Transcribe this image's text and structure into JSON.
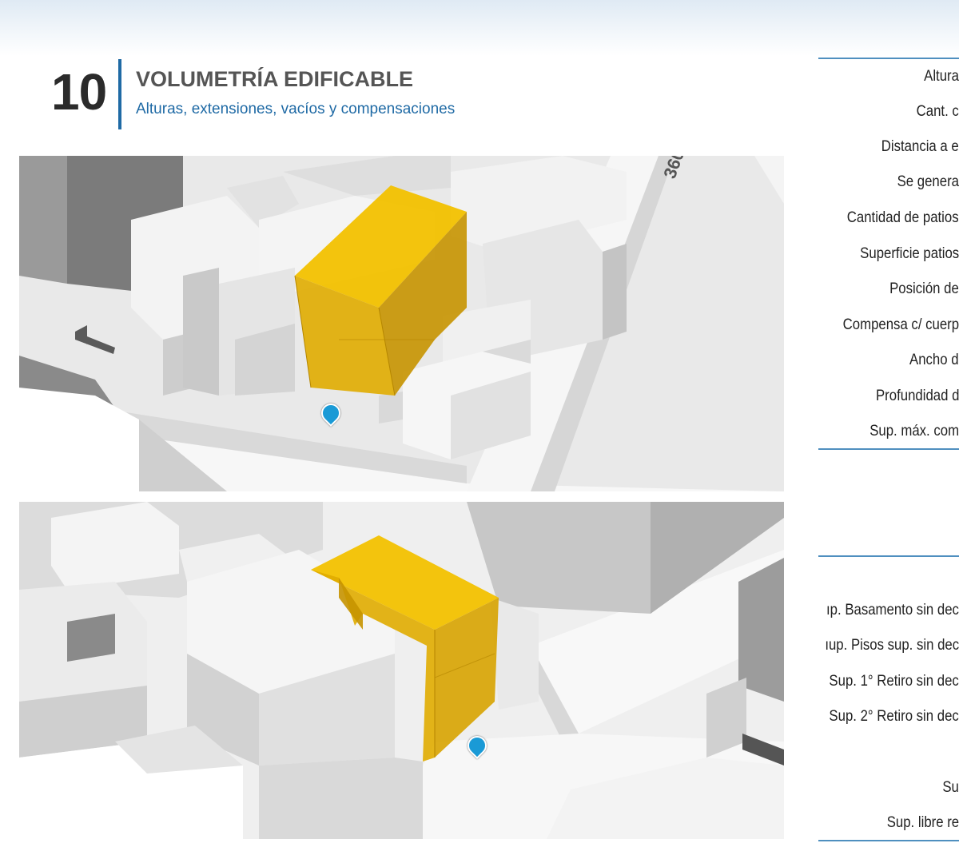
{
  "header": {
    "section_number": "10",
    "title": "VOLUMETRÍA EDIFICABLE",
    "subtitle": "Alturas, extensiones, vacíos y compensaciones"
  },
  "views": {
    "top": {
      "street_number": "360",
      "marker_icon": "location-pin-icon"
    },
    "bottom": {
      "marker_icon": "location-pin-icon"
    }
  },
  "colors": {
    "accent_blue": "#1f6aa5",
    "volume_yellow": "#f2c100",
    "marker_blue": "#1a9ad6"
  },
  "parameters_top": [
    "Altura",
    "Cant. c",
    "Distancia a e",
    "Se genera",
    "Cantidad de patios",
    "Superficie patios",
    "Posición de",
    "Compensa c/ cuerp",
    "Ancho d",
    "Profundidad d",
    "Sup. máx. com"
  ],
  "parameters_bottom": [
    "ıp. Basamento sin dec",
    "ıup. Pisos sup. sin dec",
    "Sup. 1° Retiro sin dec",
    "Sup. 2° Retiro sin dec",
    "Su",
    "Sup. libre re"
  ]
}
